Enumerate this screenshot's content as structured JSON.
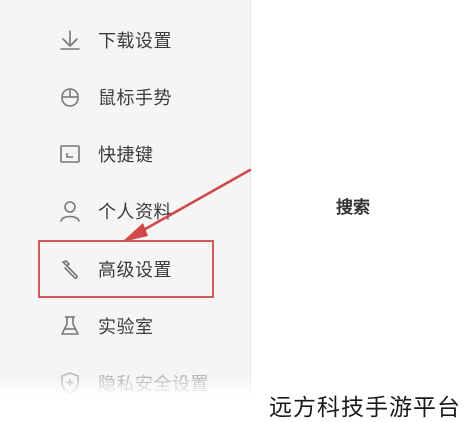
{
  "sidebar": {
    "items": [
      {
        "label": "下载设置",
        "icon": "download-icon"
      },
      {
        "label": "鼠标手势",
        "icon": "mouse-icon"
      },
      {
        "label": "快捷键",
        "icon": "keyboard-icon"
      },
      {
        "label": "个人资料",
        "icon": "person-icon"
      },
      {
        "label": "高级设置",
        "icon": "wrench-icon"
      },
      {
        "label": "实验室",
        "icon": "flask-icon"
      },
      {
        "label": "隐私安全设置",
        "icon": "shield-icon"
      }
    ]
  },
  "main": {
    "section_title": "搜索"
  },
  "annotation": {
    "highlight_color": "#d05a5a"
  },
  "watermark": {
    "text": "远方科技手游平台"
  }
}
